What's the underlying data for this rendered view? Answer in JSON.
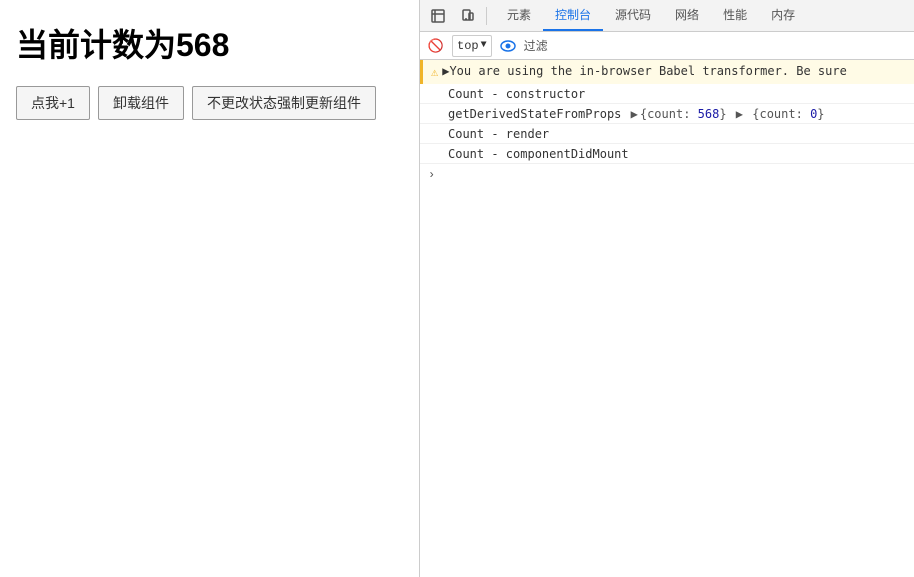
{
  "left": {
    "title": "当前计数为568",
    "buttons": [
      {
        "label": "点我+1",
        "name": "increment-button"
      },
      {
        "label": "卸载组件",
        "name": "unmount-button"
      },
      {
        "label": "不更改状态强制更新组件",
        "name": "force-update-button"
      }
    ]
  },
  "devtools": {
    "top_icons": [
      {
        "icon": "⬡",
        "name": "inspect-icon",
        "active": false
      },
      {
        "icon": "☰",
        "name": "device-icon",
        "active": false
      }
    ],
    "tabs": [
      {
        "label": "元素",
        "name": "tab-elements",
        "active": false
      },
      {
        "label": "控制台",
        "name": "tab-console",
        "active": true
      },
      {
        "label": "源代码",
        "name": "tab-sources",
        "active": false
      },
      {
        "label": "网络",
        "name": "tab-network",
        "active": false
      },
      {
        "label": "性能",
        "name": "tab-performance",
        "active": false
      },
      {
        "label": "内存",
        "name": "tab-memory",
        "active": false
      }
    ],
    "console": {
      "top_select_label": "top",
      "filter_label": "过滤",
      "warning_text": "▶You are using the in-browser Babel transformer. Be sure",
      "logs": [
        {
          "text": "Count - constructor"
        },
        {
          "text": "getDerivedStateFromProps",
          "has_objects": true,
          "obj1": "{count: 568}",
          "obj2": "{count: 0}"
        },
        {
          "text": "Count - render"
        },
        {
          "text": "Count - componentDidMount"
        }
      ],
      "prompt": ">"
    }
  }
}
